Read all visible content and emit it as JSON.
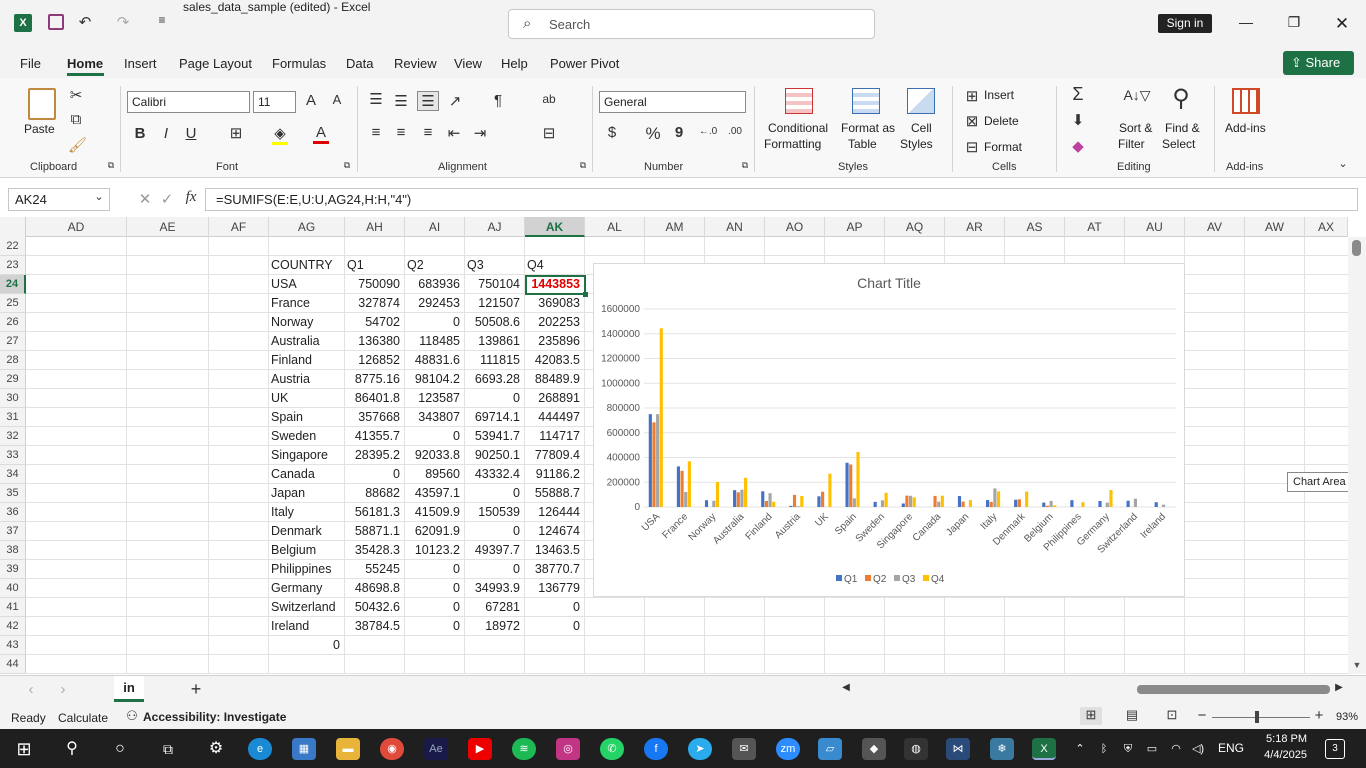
{
  "window": {
    "title": "sales_data_sample (edited)  -  Excel",
    "search_placeholder": "Search",
    "signin": "Sign in"
  },
  "menu": [
    "File",
    "Home",
    "Insert",
    "Page Layout",
    "Formulas",
    "Data",
    "Review",
    "View",
    "Help",
    "Power Pivot"
  ],
  "share": "Share",
  "ribbon": {
    "clipboard": {
      "paste": "Paste",
      "group": "Clipboard"
    },
    "font": {
      "name": "Calibri",
      "size": "11",
      "group": "Font"
    },
    "alignment": {
      "group": "Alignment"
    },
    "number": {
      "format": "General",
      "group": "Number"
    },
    "styles": {
      "cond1": "Conditional",
      "cond2": "Formatting",
      "fmt1": "Format as",
      "fmt2": "Table",
      "cell1": "Cell",
      "cell2": "Styles",
      "group": "Styles"
    },
    "cells": {
      "insert": "Insert",
      "delete": "Delete",
      "format": "Format",
      "group": "Cells"
    },
    "editing": {
      "sort1": "Sort &",
      "sort2": "Filter",
      "find1": "Find &",
      "find2": "Select",
      "group": "Editing"
    },
    "addins": {
      "label": "Add-ins",
      "group": "Add-ins"
    }
  },
  "formula_bar": {
    "name_box": "AK24",
    "formula": "=SUMIFS(E:E,U:U,AG24,H:H,\"4\")"
  },
  "columns": [
    "AD",
    "AE",
    "AF",
    "AG",
    "AH",
    "AI",
    "AJ",
    "AK",
    "AL",
    "AM",
    "AN",
    "AO",
    "AP",
    "AQ",
    "AR",
    "AS",
    "AT",
    "AU",
    "AV",
    "AW",
    "AX"
  ],
  "rows": [
    "22",
    "23",
    "24",
    "25",
    "26",
    "27",
    "28",
    "29",
    "30",
    "31",
    "32",
    "33",
    "34",
    "35",
    "36",
    "37",
    "38",
    "39",
    "40",
    "41",
    "42",
    "43",
    "44"
  ],
  "table": {
    "header": [
      "COUNTRY",
      "Q1",
      "Q2",
      "Q3",
      "Q4"
    ],
    "data": [
      [
        "USA",
        "750090",
        "683936",
        "750104",
        "1443853"
      ],
      [
        "France",
        "327874",
        "292453",
        "121507",
        "369083"
      ],
      [
        "Norway",
        "54702",
        "0",
        "50508.6",
        "202253"
      ],
      [
        "Australia",
        "136380",
        "118485",
        "139861",
        "235896"
      ],
      [
        "Finland",
        "126852",
        "48831.6",
        "111815",
        "42083.5"
      ],
      [
        "Austria",
        "8775.16",
        "98104.2",
        "6693.28",
        "88489.9"
      ],
      [
        "UK",
        "86401.8",
        "123587",
        "0",
        "268891"
      ],
      [
        "Spain",
        "357668",
        "343807",
        "69714.1",
        "444497"
      ],
      [
        "Sweden",
        "41355.7",
        "0",
        "53941.7",
        "114717"
      ],
      [
        "Singapore",
        "28395.2",
        "92033.8",
        "90250.1",
        "77809.4"
      ],
      [
        "Canada",
        "0",
        "89560",
        "43332.4",
        "91186.2"
      ],
      [
        "Japan",
        "88682",
        "43597.1",
        "0",
        "55888.7"
      ],
      [
        "Italy",
        "56181.3",
        "41509.9",
        "150539",
        "126444"
      ],
      [
        "Denmark",
        "58871.1",
        "62091.9",
        "0",
        "124674"
      ],
      [
        "Belgium",
        "35428.3",
        "10123.2",
        "49397.7",
        "13463.5"
      ],
      [
        "Philippines",
        "55245",
        "0",
        "0",
        "38770.7"
      ],
      [
        "Germany",
        "48698.8",
        "0",
        "34993.9",
        "136779"
      ],
      [
        "Switzerland",
        "50432.6",
        "0",
        "67281",
        "0"
      ],
      [
        "Ireland",
        "38784.5",
        "0",
        "18972",
        "0"
      ]
    ],
    "extra_zero": "0"
  },
  "chart_data": {
    "type": "bar",
    "title": "Chart Title",
    "categories": [
      "USA",
      "France",
      "Norway",
      "Australia",
      "Finland",
      "Austria",
      "UK",
      "Spain",
      "Sweden",
      "Singapore",
      "Canada",
      "Japan",
      "Italy",
      "Denmark",
      "Belgium",
      "Philippines",
      "Germany",
      "Switzerland",
      "Ireland"
    ],
    "series": [
      {
        "name": "Q1",
        "color": "#4472c4",
        "values": [
          750090,
          327874,
          54702,
          136380,
          126852,
          8775.16,
          86401.8,
          357668,
          41355.7,
          28395.2,
          0,
          88682,
          56181.3,
          58871.1,
          35428.3,
          55245,
          48698.8,
          50432.6,
          38784.5
        ]
      },
      {
        "name": "Q2",
        "color": "#ed7d31",
        "values": [
          683936,
          292453,
          0,
          118485,
          48831.6,
          98104.2,
          123587,
          343807,
          0,
          92033.8,
          89560,
          43597.1,
          41509.9,
          62091.9,
          10123.2,
          0,
          0,
          0,
          0
        ]
      },
      {
        "name": "Q3",
        "color": "#a5a5a5",
        "values": [
          750104,
          121507,
          50508.6,
          139861,
          111815,
          6693.28,
          0,
          69714.1,
          53941.7,
          90250.1,
          43332.4,
          0,
          150539,
          0,
          49397.7,
          0,
          34993.9,
          67281,
          18972
        ]
      },
      {
        "name": "Q4",
        "color": "#ffc000",
        "values": [
          1443853,
          369083,
          202253,
          235896,
          42083.5,
          88489.9,
          268891,
          444497,
          114717,
          77809.4,
          91186.2,
          55888.7,
          126444,
          124674,
          13463.5,
          38770.7,
          136779,
          0,
          0
        ]
      }
    ],
    "yticks": [
      "0",
      "200000",
      "400000",
      "600000",
      "800000",
      "1000000",
      "1200000",
      "1400000",
      "1600000"
    ],
    "ylim": [
      0,
      1600000
    ],
    "legend": "bottom",
    "grid": true
  },
  "tooltip": "Chart Area",
  "sheet_tab": "in",
  "status": {
    "ready": "Ready",
    "calculate": "Calculate",
    "accessibility": "Accessibility: Investigate",
    "zoom": "93%"
  },
  "taskbar": {
    "lang": "ENG",
    "time": "5:18 PM",
    "date": "4/4/2025",
    "notif": "3"
  }
}
